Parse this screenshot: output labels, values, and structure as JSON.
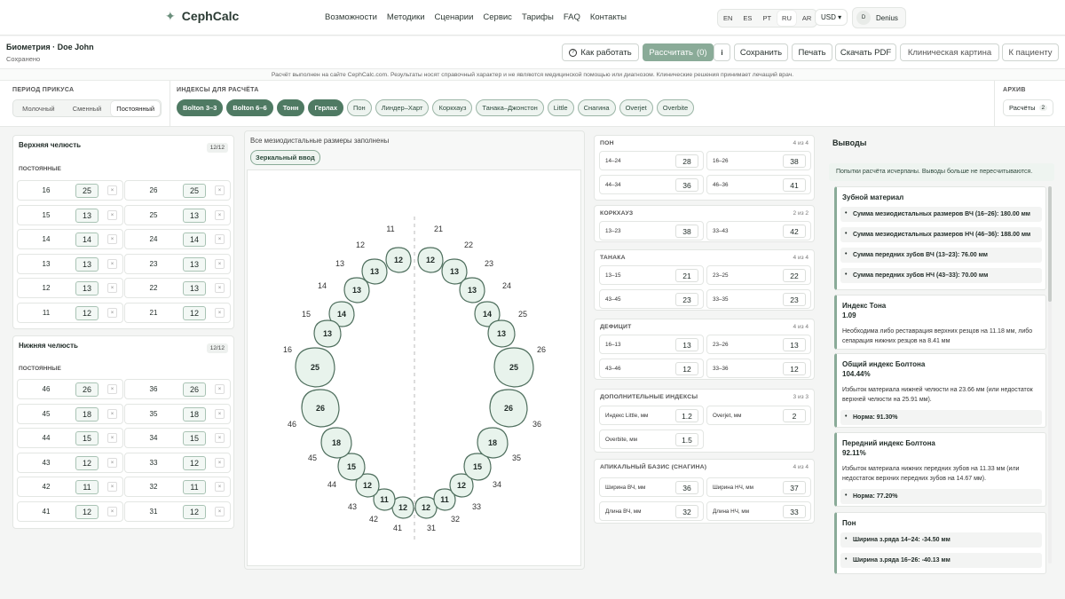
{
  "app": {
    "name": "CephCalc"
  },
  "nav": [
    "Возможности",
    "Методики",
    "Сценарии",
    "Сервис",
    "Тарифы",
    "FAQ",
    "Контакты"
  ],
  "langs": [
    "EN",
    "ES",
    "PT",
    "RU",
    "AR"
  ],
  "currency": "USD ▾",
  "user": {
    "initial": "D",
    "name": "Denius"
  },
  "patient": {
    "title": "Биометрия · Doe John",
    "status": "Сохранено"
  },
  "toolbar": {
    "how": "Как работать",
    "calc": "Рассчитать",
    "calc_count": "(0)",
    "info": "i",
    "save": "Сохранить",
    "print": "Печать",
    "pdf": "Скачать PDF",
    "clinical": "Клиническая картина",
    "to_patient": "К пациенту"
  },
  "disclaimer": "Расчёт выполнен на сайте CephCalc.com. Результаты носят справочный характер и не являются медицинской помощью или диагнозом. Клинические решения принимает лечащий врач.",
  "period": {
    "label": "ПЕРИОД ПРИКУСА",
    "options": [
      "Молочный",
      "Сменный",
      "Постоянный"
    ],
    "selected": 2
  },
  "indices": {
    "label": "ИНДЕКСЫ ДЛЯ РАСЧЁТА",
    "chips": [
      {
        "label": "Bolton 3–3",
        "active": true
      },
      {
        "label": "Bolton 6–6",
        "active": true
      },
      {
        "label": "Тонн",
        "active": true
      },
      {
        "label": "Герлах",
        "active": true
      },
      {
        "label": "Пон",
        "active": false
      },
      {
        "label": "Линдер–Харт",
        "active": false
      },
      {
        "label": "Коркхауз",
        "active": false
      },
      {
        "label": "Танака–Джонстон",
        "active": false
      },
      {
        "label": "Little",
        "active": false
      },
      {
        "label": "Снагина",
        "active": false
      },
      {
        "label": "Overjet",
        "active": false
      },
      {
        "label": "Overbite",
        "active": false
      }
    ]
  },
  "archive": {
    "label": "АРХИВ",
    "button": "Расчёты",
    "count": "2"
  },
  "upper": {
    "title": "Верхняя челюсть",
    "count": "12/12",
    "sub": "ПОСТОЯННЫЕ",
    "teeth": [
      [
        "16",
        "25",
        "26",
        "25"
      ],
      [
        "15",
        "13",
        "25",
        "13"
      ],
      [
        "14",
        "14",
        "24",
        "14"
      ],
      [
        "13",
        "13",
        "23",
        "13"
      ],
      [
        "12",
        "13",
        "22",
        "13"
      ],
      [
        "11",
        "12",
        "21",
        "12"
      ]
    ]
  },
  "lower": {
    "title": "Нижняя челюсть",
    "count": "12/12",
    "sub": "ПОСТОЯННЫЕ",
    "teeth": [
      [
        "46",
        "26",
        "36",
        "26"
      ],
      [
        "45",
        "18",
        "35",
        "18"
      ],
      [
        "44",
        "15",
        "34",
        "15"
      ],
      [
        "43",
        "12",
        "33",
        "12"
      ],
      [
        "42",
        "11",
        "32",
        "11"
      ],
      [
        "41",
        "12",
        "31",
        "12"
      ]
    ]
  },
  "remove_mark": "×",
  "chart_note": "Все мезиодистальные размеры заполнены",
  "mirror": "Зеркальный ввод",
  "arch": {
    "upper": [
      {
        "n": "11",
        "v": "12"
      },
      {
        "n": "12",
        "v": "13"
      },
      {
        "n": "13",
        "v": "13"
      },
      {
        "n": "14",
        "v": "14"
      },
      {
        "n": "15",
        "v": "13"
      },
      {
        "n": "16",
        "v": "25"
      },
      {
        "n": "21",
        "v": "12"
      },
      {
        "n": "22",
        "v": "13"
      },
      {
        "n": "23",
        "v": "13"
      },
      {
        "n": "24",
        "v": "14"
      },
      {
        "n": "25",
        "v": "13"
      },
      {
        "n": "26",
        "v": "25"
      }
    ],
    "lower": [
      {
        "n": "41",
        "v": "12"
      },
      {
        "n": "42",
        "v": "11"
      },
      {
        "n": "43",
        "v": "12"
      },
      {
        "n": "44",
        "v": "15"
      },
      {
        "n": "45",
        "v": "18"
      },
      {
        "n": "46",
        "v": "26"
      },
      {
        "n": "31",
        "v": "12"
      },
      {
        "n": "32",
        "v": "11"
      },
      {
        "n": "33",
        "v": "12"
      },
      {
        "n": "34",
        "v": "15"
      },
      {
        "n": "35",
        "v": "18"
      },
      {
        "n": "36",
        "v": "26"
      }
    ]
  },
  "sections": [
    {
      "title": "ПОН",
      "count": "4 из 4",
      "cells": [
        [
          "14–24",
          "28"
        ],
        [
          "16–26",
          "38"
        ],
        [
          "44–34",
          "36"
        ],
        [
          "46–36",
          "41"
        ]
      ]
    },
    {
      "title": "КОРКХАУЗ",
      "count": "2 из 2",
      "cells": [
        [
          "13–23",
          "38"
        ],
        [
          "33–43",
          "42"
        ]
      ]
    },
    {
      "title": "ТАНАКА",
      "count": "4 из 4",
      "cells": [
        [
          "13–15",
          "21"
        ],
        [
          "23–25",
          "22"
        ],
        [
          "43–45",
          "23"
        ],
        [
          "33–35",
          "23"
        ]
      ]
    },
    {
      "title": "ДЕФИЦИТ",
      "count": "4 из 4",
      "cells": [
        [
          "16–13",
          "13"
        ],
        [
          "23–26",
          "13"
        ],
        [
          "43–46",
          "12"
        ],
        [
          "33–36",
          "12"
        ]
      ]
    },
    {
      "title": "ДОПОЛНИТЕЛЬНЫЕ ИНДЕКСЫ",
      "count": "3 из 3",
      "cells": [
        [
          "Индекс Little, мм",
          "1.2"
        ],
        [
          "Overjet, мм",
          "2"
        ],
        [
          "Overbite, мм",
          "1.5"
        ]
      ]
    },
    {
      "title": "АПИКАЛЬНЫЙ БАЗИС (СНАГИНА)",
      "count": "4 из 4",
      "cells": [
        [
          "Ширина ВЧ, мм",
          "36"
        ],
        [
          "Ширина НЧ, мм",
          "37"
        ],
        [
          "Длина ВЧ, мм",
          "32"
        ],
        [
          "Длина НЧ, мм",
          "33"
        ]
      ]
    }
  ],
  "conclusions": {
    "title": "Выводы",
    "alert": "Попытки расчёта исчерпаны. Выводы больше не пересчитываются.",
    "cards": [
      {
        "title": "Зубной материал",
        "value": "",
        "text": "",
        "bullets": [
          "Сумма мезиодистальных размеров ВЧ (16–26): 180.00 мм",
          "Сумма мезиодистальных размеров НЧ (46–36): 188.00 мм",
          "Сумма передних зубов ВЧ (13–23): 76.00 мм",
          "Сумма передних зубов НЧ (43–33): 70.00 мм"
        ]
      },
      {
        "title": "Индекс Тона",
        "value": "1.09",
        "text": "Необходима либо реставрация верхних резцов на 11.18 мм, либо сепарация нижних резцов на 8.41 мм",
        "bullets": []
      },
      {
        "title": "Общий индекс Болтона",
        "value": "104.44%",
        "text": "Избыток материала нижней челюсти на 23.66 мм (или недостаток верхней челюсти на 25.91 мм).",
        "bullets": [
          "Норма: 91.30%"
        ]
      },
      {
        "title": "Передний индекс Болтона",
        "value": "92.11%",
        "text": "Избыток материала нижних передних зубов на 11.33 мм (или недостаток верхних передних зубов на 14.67 мм).",
        "bullets": [
          "Норма: 77.20%"
        ]
      },
      {
        "title": "Пон",
        "value": "",
        "text": "",
        "bullets": [
          "Ширина з.ряда 14–24: -34.50 мм",
          "Ширина з.ряда 16–26: -40.13 мм"
        ]
      }
    ]
  }
}
